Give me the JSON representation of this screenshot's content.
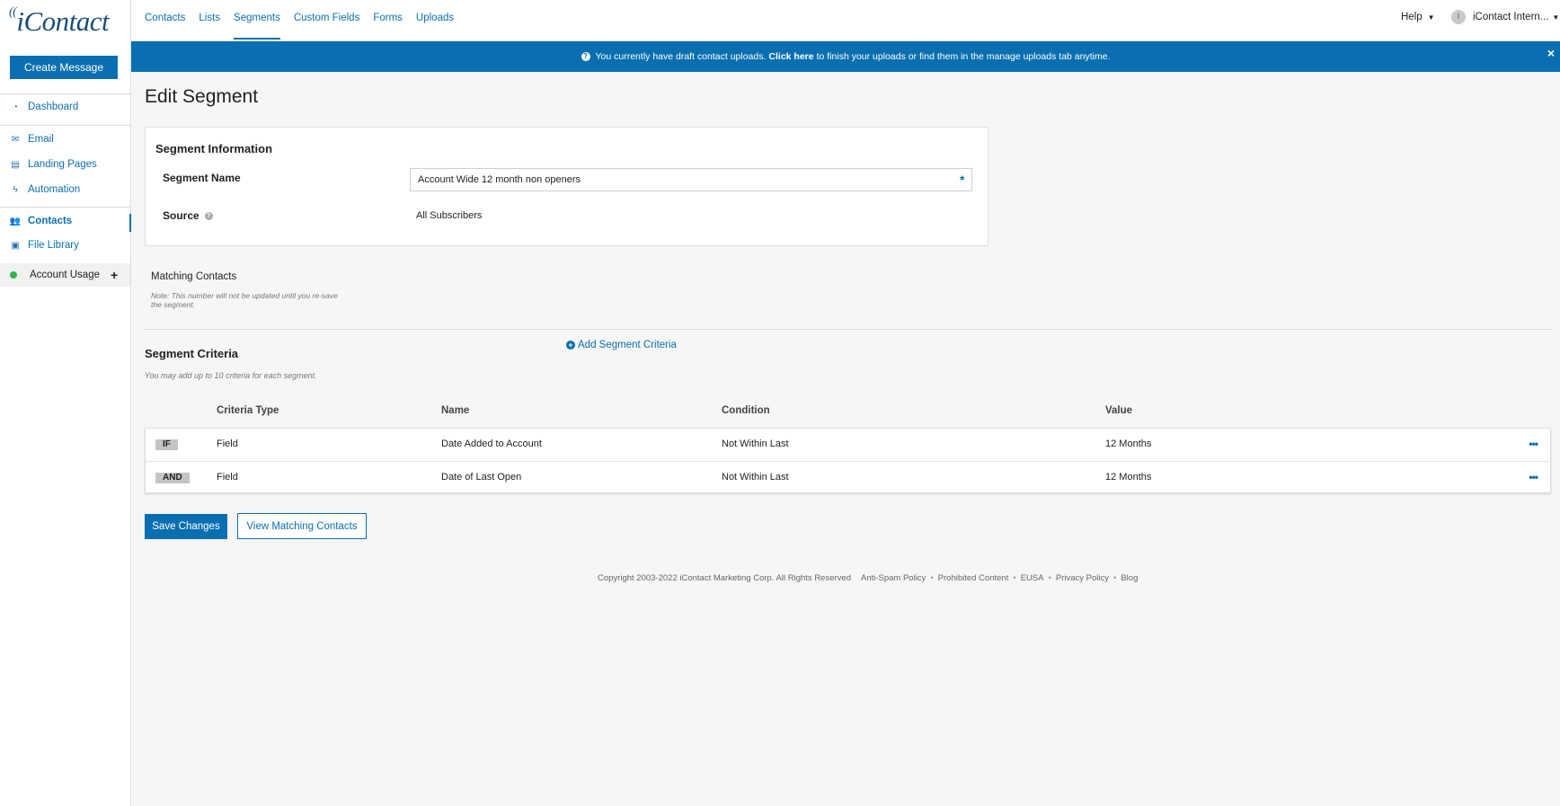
{
  "brand": {
    "logo_text": "iContact"
  },
  "sidebar": {
    "create_button": "Create Message",
    "items": [
      {
        "label": "Dashboard",
        "icon": "dashboard-icon"
      },
      {
        "label": "Email",
        "icon": "envelope-icon"
      },
      {
        "label": "Landing Pages",
        "icon": "landing-page-icon"
      },
      {
        "label": "Automation",
        "icon": "bolt-icon"
      },
      {
        "label": "Contacts",
        "icon": "users-icon"
      },
      {
        "label": "File Library",
        "icon": "image-icon"
      }
    ],
    "account_usage": "Account Usage"
  },
  "topnav": {
    "tabs": [
      "Contacts",
      "Lists",
      "Segments",
      "Custom Fields",
      "Forms",
      "Uploads"
    ],
    "active": "Segments",
    "help": "Help",
    "user": "iContact Intern...",
    "avatar_letter": "I"
  },
  "banner": {
    "pre": "You currently have draft contact uploads.",
    "link": "Click here",
    "post": "to finish your uploads or find them in the manage uploads tab anytime."
  },
  "page": {
    "title": "Edit Segment",
    "segment_info": {
      "heading": "Segment Information",
      "name_label": "Segment Name",
      "name_value": "Account Wide 12 month non openers",
      "source_label": "Source",
      "source_value": "All Subscribers"
    },
    "matching": {
      "title": "Matching Contacts",
      "note": "Note: This number will not be updated until you re-save the segment."
    },
    "criteria": {
      "title": "Segment Criteria",
      "note": "You may add up to 10 criteria for each segment.",
      "add_label": "Add Segment Criteria",
      "headers": [
        "Criteria Type",
        "Name",
        "Condition",
        "Value"
      ],
      "rows": [
        {
          "op": "IF",
          "type": "Field",
          "name": "Date Added to Account",
          "condition": "Not Within Last",
          "value": "12 Months"
        },
        {
          "op": "AND",
          "type": "Field",
          "name": "Date of Last Open",
          "condition": "Not Within Last",
          "value": "12 Months"
        }
      ]
    },
    "buttons": {
      "save": "Save Changes",
      "view": "View Matching Contacts"
    }
  },
  "footer": {
    "copyright": "Copyright 2003-2022 iContact Marketing Corp. All Rights Reserved",
    "links": [
      "Anti-Spam Policy",
      "Prohibited Content",
      "EUSA",
      "Privacy Policy",
      "Blog"
    ]
  },
  "colors": {
    "primary": "#0a6fb0",
    "status_green": "#2eb84b"
  }
}
